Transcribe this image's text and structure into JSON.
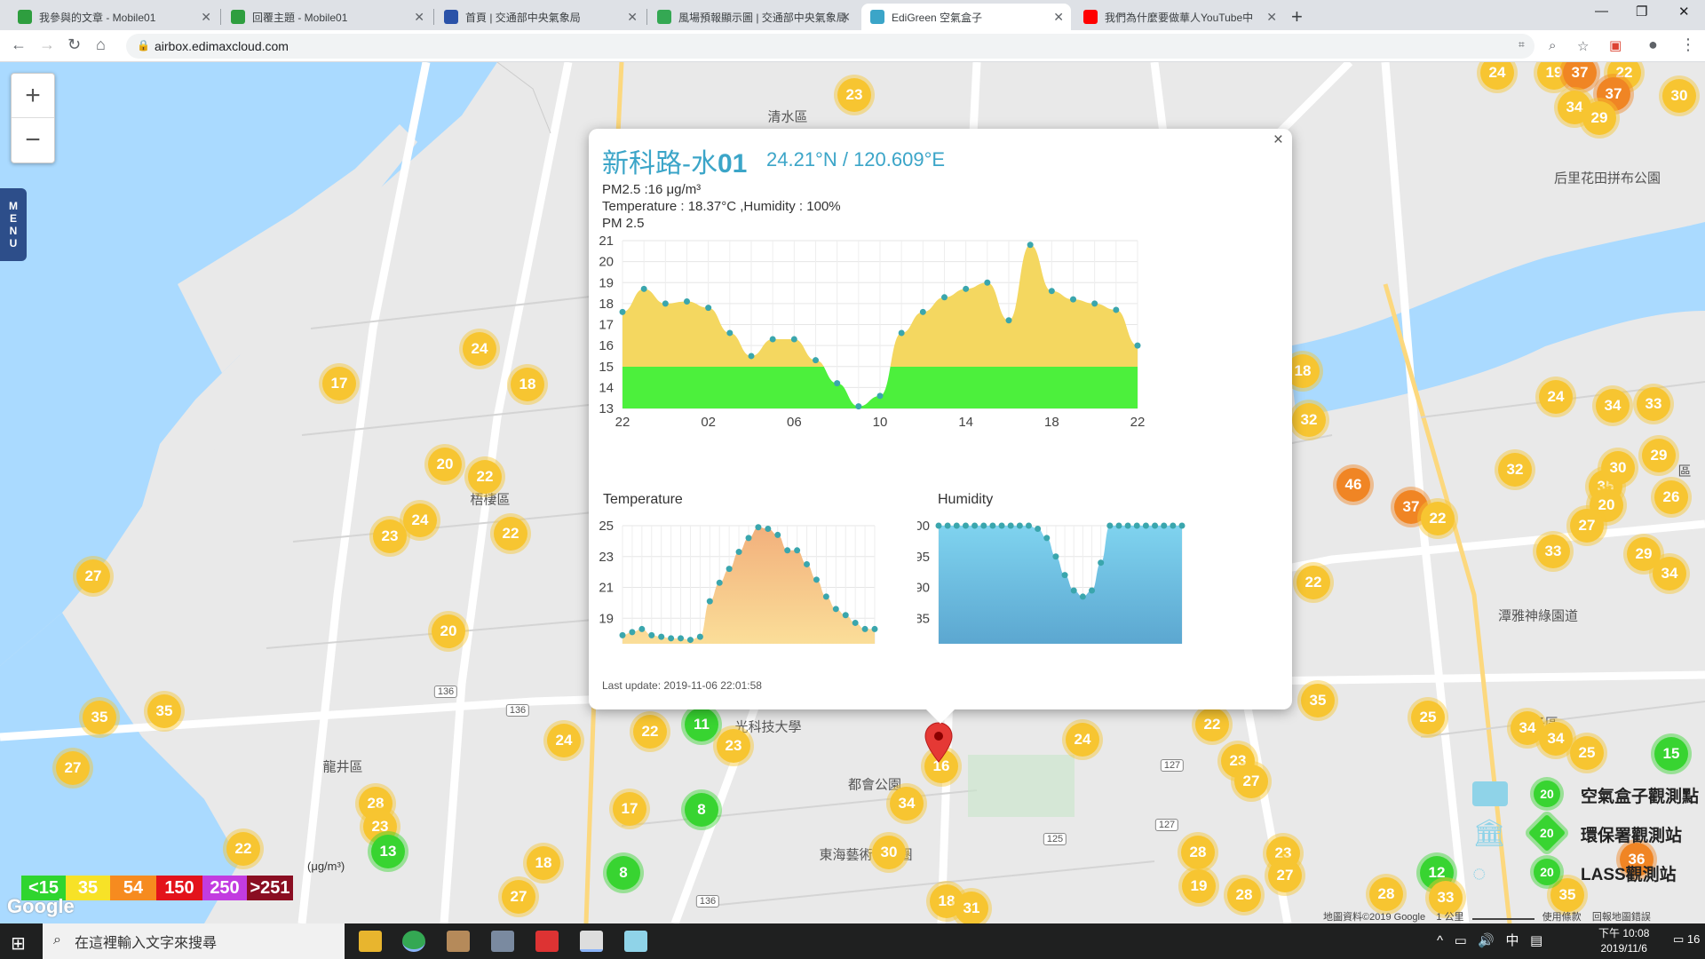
{
  "browser": {
    "tabs": [
      {
        "title": "我參與的文章 - Mobile01",
        "icon": "mobile01-favicon",
        "color": "#2e9e3f"
      },
      {
        "title": "回覆主題 - Mobile01",
        "icon": "mobile01-favicon",
        "color": "#2e9e3f"
      },
      {
        "title": "首頁 | 交通部中央氣象局",
        "icon": "cwb-favicon",
        "color": "#2a52a8"
      },
      {
        "title": "風場預報顯示圖 | 交通部中央氣象局",
        "icon": "cwb-wind-favicon",
        "color": "#34a853"
      },
      {
        "title": "EdiGreen 空氣盒子",
        "icon": "edigreen-favicon",
        "color": "#3ba5c8",
        "active": true
      },
      {
        "title": "我們為什麼要做華人YouTube中",
        "icon": "youtube-favicon",
        "color": "#ff0000"
      }
    ],
    "url": "airbox.edimaxcloud.com"
  },
  "map": {
    "places": [
      {
        "name": "清水區",
        "x": 887,
        "y": 131
      },
      {
        "name": "梧棲區",
        "x": 552,
        "y": 562
      },
      {
        "name": "龍井區",
        "x": 386,
        "y": 863
      },
      {
        "name": "都會公園",
        "x": 985,
        "y": 883
      },
      {
        "name": "東海藝術街商圈",
        "x": 975,
        "y": 962
      },
      {
        "name": "光科技大學",
        "x": 865,
        "y": 818
      },
      {
        "name": "后里花田拼布公園",
        "x": 1810,
        "y": 200
      },
      {
        "name": "潭雅神綠園道",
        "x": 1732,
        "y": 693
      },
      {
        "name": "子區",
        "x": 1740,
        "y": 814
      },
      {
        "name": "台灣",
        "x": 1705,
        "y": 524
      },
      {
        "name": "區",
        "x": 1897,
        "y": 530
      }
    ],
    "markers": [
      {
        "v": "24",
        "x": 1686,
        "y": 82,
        "c": "y"
      },
      {
        "v": "19",
        "x": 1750,
        "y": 82,
        "c": "y"
      },
      {
        "v": "37",
        "x": 1779,
        "y": 82,
        "c": "o"
      },
      {
        "v": "22",
        "x": 1829,
        "y": 82,
        "c": "y"
      },
      {
        "v": "37",
        "x": 1817,
        "y": 106,
        "c": "o"
      },
      {
        "v": "30",
        "x": 1891,
        "y": 108,
        "c": "y"
      },
      {
        "v": "34",
        "x": 1773,
        "y": 121,
        "c": "y"
      },
      {
        "v": "29",
        "x": 1801,
        "y": 133,
        "c": "y"
      },
      {
        "v": "23",
        "x": 962,
        "y": 107,
        "c": "y"
      },
      {
        "v": "24",
        "x": 540,
        "y": 393,
        "c": "y"
      },
      {
        "v": "17",
        "x": 382,
        "y": 432,
        "c": "y"
      },
      {
        "v": "18",
        "x": 594,
        "y": 433,
        "c": "y"
      },
      {
        "v": "20",
        "x": 501,
        "y": 523,
        "c": "y"
      },
      {
        "v": "22",
        "x": 546,
        "y": 537,
        "c": "y"
      },
      {
        "v": "24",
        "x": 473,
        "y": 586,
        "c": "y"
      },
      {
        "v": "22",
        "x": 575,
        "y": 601,
        "c": "y"
      },
      {
        "v": "23",
        "x": 439,
        "y": 604,
        "c": "y"
      },
      {
        "v": "27",
        "x": 105,
        "y": 649,
        "c": "y"
      },
      {
        "v": "20",
        "x": 505,
        "y": 711,
        "c": "y"
      },
      {
        "v": "35",
        "x": 112,
        "y": 808,
        "c": "y"
      },
      {
        "v": "35",
        "x": 185,
        "y": 801,
        "c": "y"
      },
      {
        "v": "27",
        "x": 82,
        "y": 865,
        "c": "y"
      },
      {
        "v": "28",
        "x": 423,
        "y": 905,
        "c": "y"
      },
      {
        "v": "23",
        "x": 428,
        "y": 931,
        "c": "y"
      },
      {
        "v": "13",
        "x": 437,
        "y": 959,
        "c": "g"
      },
      {
        "v": "22",
        "x": 274,
        "y": 956,
        "c": "y"
      },
      {
        "v": "18",
        "x": 612,
        "y": 972,
        "c": "y"
      },
      {
        "v": "27",
        "x": 584,
        "y": 1010,
        "c": "y"
      },
      {
        "v": "8",
        "x": 702,
        "y": 983,
        "c": "g"
      },
      {
        "v": "17",
        "x": 709,
        "y": 911,
        "c": "y"
      },
      {
        "v": "8",
        "x": 790,
        "y": 912,
        "c": "g"
      },
      {
        "v": "22",
        "x": 732,
        "y": 824,
        "c": "y"
      },
      {
        "v": "11",
        "x": 790,
        "y": 816,
        "c": "g"
      },
      {
        "v": "23",
        "x": 826,
        "y": 840,
        "c": "y"
      },
      {
        "v": "24",
        "x": 635,
        "y": 834,
        "c": "y"
      },
      {
        "v": "16",
        "x": 1060,
        "y": 863,
        "c": "y"
      },
      {
        "v": "34",
        "x": 1021,
        "y": 905,
        "c": "y"
      },
      {
        "v": "30",
        "x": 1001,
        "y": 960,
        "c": "y"
      },
      {
        "v": "18",
        "x": 1066,
        "y": 1015,
        "c": "y"
      },
      {
        "v": "31",
        "x": 1094,
        "y": 1023,
        "c": "y"
      },
      {
        "v": "24",
        "x": 1219,
        "y": 833,
        "c": "y"
      },
      {
        "v": "22",
        "x": 1365,
        "y": 816,
        "c": "y"
      },
      {
        "v": "23",
        "x": 1394,
        "y": 857,
        "c": "y"
      },
      {
        "v": "27",
        "x": 1409,
        "y": 880,
        "c": "y"
      },
      {
        "v": "28",
        "x": 1349,
        "y": 960,
        "c": "y"
      },
      {
        "v": "23",
        "x": 1445,
        "y": 961,
        "c": "y"
      },
      {
        "v": "27",
        "x": 1447,
        "y": 986,
        "c": "y"
      },
      {
        "v": "19",
        "x": 1350,
        "y": 998,
        "c": "y"
      },
      {
        "v": "28",
        "x": 1401,
        "y": 1008,
        "c": "y"
      },
      {
        "v": "35",
        "x": 1484,
        "y": 789,
        "c": "y"
      },
      {
        "v": "25",
        "x": 1608,
        "y": 808,
        "c": "y"
      },
      {
        "v": "34",
        "x": 1720,
        "y": 820,
        "c": "y"
      },
      {
        "v": "34",
        "x": 1752,
        "y": 832,
        "c": "y"
      },
      {
        "v": "25",
        "x": 1787,
        "y": 848,
        "c": "y"
      },
      {
        "v": "15",
        "x": 1882,
        "y": 849,
        "c": "g"
      },
      {
        "v": "12",
        "x": 1618,
        "y": 983,
        "c": "g"
      },
      {
        "v": "33",
        "x": 1628,
        "y": 1011,
        "c": "y"
      },
      {
        "v": "28",
        "x": 1561,
        "y": 1007,
        "c": "y"
      },
      {
        "v": "35",
        "x": 1765,
        "y": 1008,
        "c": "y"
      },
      {
        "v": "36",
        "x": 1843,
        "y": 968,
        "c": "o"
      },
      {
        "v": "18",
        "x": 1467,
        "y": 418,
        "c": "y"
      },
      {
        "v": "32",
        "x": 1474,
        "y": 473,
        "c": "y"
      },
      {
        "v": "24",
        "x": 1752,
        "y": 447,
        "c": "y"
      },
      {
        "v": "34",
        "x": 1816,
        "y": 457,
        "c": "y"
      },
      {
        "v": "33",
        "x": 1862,
        "y": 455,
        "c": "y"
      },
      {
        "v": "29",
        "x": 1868,
        "y": 513,
        "c": "y"
      },
      {
        "v": "46",
        "x": 1524,
        "y": 546,
        "c": "o"
      },
      {
        "v": "37",
        "x": 1589,
        "y": 571,
        "c": "o"
      },
      {
        "v": "22",
        "x": 1619,
        "y": 584,
        "c": "y"
      },
      {
        "v": "32",
        "x": 1706,
        "y": 529,
        "c": "y"
      },
      {
        "v": "35",
        "x": 1808,
        "y": 548,
        "c": "y"
      },
      {
        "v": "20",
        "x": 1809,
        "y": 569,
        "c": "y"
      },
      {
        "v": "30",
        "x": 1822,
        "y": 527,
        "c": "y"
      },
      {
        "v": "26",
        "x": 1882,
        "y": 560,
        "c": "y"
      },
      {
        "v": "27",
        "x": 1787,
        "y": 592,
        "c": "y"
      },
      {
        "v": "33",
        "x": 1749,
        "y": 621,
        "c": "y"
      },
      {
        "v": "29",
        "x": 1851,
        "y": 624,
        "c": "y"
      },
      {
        "v": "34",
        "x": 1880,
        "y": 646,
        "c": "y"
      },
      {
        "v": "22",
        "x": 1479,
        "y": 656,
        "c": "y"
      }
    ],
    "roads": [
      {
        "v": "136",
        "x": 502,
        "y": 779
      },
      {
        "v": "136",
        "x": 583,
        "y": 800
      },
      {
        "v": "136",
        "x": 797,
        "y": 1015
      },
      {
        "v": "125",
        "x": 1188,
        "y": 945
      },
      {
        "v": "127",
        "x": 1320,
        "y": 862
      },
      {
        "v": "127",
        "x": 1314,
        "y": 929
      }
    ],
    "legend": {
      "scale": [
        {
          "label": "<15",
          "color": "#2fd52f"
        },
        {
          "label": "35",
          "color": "#f7e227"
        },
        {
          "label": "54",
          "color": "#f68b1f"
        },
        {
          "label": "150",
          "color": "#e3131b"
        },
        {
          "label": "250",
          "color": "#c23ce0"
        },
        {
          "label": ">251",
          "color": "#8a0e22"
        }
      ],
      "unit": "(μg/m³)",
      "station_types": [
        {
          "label": "空氣盒子觀測點",
          "value": "20"
        },
        {
          "label": "環保署觀測站",
          "value": "20"
        },
        {
          "label": "LASS觀測站",
          "value": "20"
        }
      ]
    },
    "google_logo": "Google",
    "footer": {
      "data": "地圖資料©2019 Google",
      "scale": "1 公里",
      "terms": "使用條款",
      "report": "回報地圖錯誤"
    },
    "menu_label": [
      "M",
      "E",
      "N",
      "U"
    ]
  },
  "popup": {
    "site_name_prefix": "新科路-水",
    "site_name_bold": "01",
    "coords": "24.21°N / 120.609°E",
    "pm25_line": "PM2.5 :16 μg/m³",
    "temp_line": "Temperature : 18.37°C ,Humidity : 100%",
    "pm_title": "PM 2.5",
    "temp_title": "Temperature",
    "humid_title": "Humidity",
    "last_update": "Last update: 2019-11-06 22:01:58"
  },
  "chart_data": [
    {
      "type": "area",
      "title": "PM 2.5",
      "x": [
        "22",
        "23",
        "00",
        "01",
        "02",
        "03",
        "04",
        "05",
        "06",
        "07",
        "08",
        "09",
        "10",
        "11",
        "12",
        "13",
        "14",
        "15",
        "16",
        "17",
        "18",
        "19",
        "20",
        "21",
        "22"
      ],
      "xticks": [
        "22",
        "02",
        "06",
        "10",
        "14",
        "18",
        "22"
      ],
      "values": [
        17.6,
        18.7,
        18.0,
        18.1,
        17.8,
        16.6,
        15.5,
        16.3,
        16.3,
        15.3,
        14.2,
        13.1,
        13.6,
        16.6,
        17.6,
        18.3,
        18.7,
        19.0,
        17.2,
        20.8,
        18.6,
        18.2,
        18.0,
        17.7,
        16.0
      ],
      "ylim": [
        13,
        21
      ],
      "yticks": [
        13,
        14,
        15,
        16,
        17,
        18,
        19,
        20,
        21
      ],
      "threshold": 15,
      "colors": {
        "above": "#f4d760",
        "below": "#4cf03c",
        "points": "#3aa6ad"
      }
    },
    {
      "type": "area",
      "title": "Temperature",
      "values": [
        17.9,
        18.1,
        18.3,
        17.9,
        17.8,
        17.7,
        17.7,
        17.6,
        17.8,
        20.1,
        21.3,
        22.2,
        23.3,
        24.2,
        24.9,
        24.8,
        24.4,
        23.4,
        23.4,
        22.5,
        21.5,
        20.4,
        19.6,
        19.2,
        18.7,
        18.3,
        18.3
      ],
      "ylim": [
        17,
        25
      ],
      "yticks": [
        17,
        19,
        21,
        23,
        25
      ],
      "colors": {
        "top": "#f2b07c",
        "bottom": "#fbe09a",
        "points": "#3aa6ad"
      }
    },
    {
      "type": "area",
      "title": "Humidity",
      "values": [
        100,
        100,
        100,
        100,
        100,
        100,
        100,
        100,
        100,
        100,
        100,
        99.5,
        98,
        95,
        92,
        89.5,
        88.5,
        89.5,
        94,
        100,
        100,
        100,
        100,
        100,
        100,
        100,
        100,
        100
      ],
      "ylim": [
        80,
        100
      ],
      "yticks": [
        80,
        85,
        90,
        95,
        100
      ],
      "colors": {
        "top": "#7fd3ef",
        "bottom": "#5aa5cf",
        "points": "#3aa6ad"
      }
    }
  ],
  "taskbar": {
    "search_placeholder": "在這裡輸入文字來搜尋",
    "time": "下午 10:08",
    "date": "2019/11/6",
    "ime": "中",
    "notification_count": "16"
  }
}
